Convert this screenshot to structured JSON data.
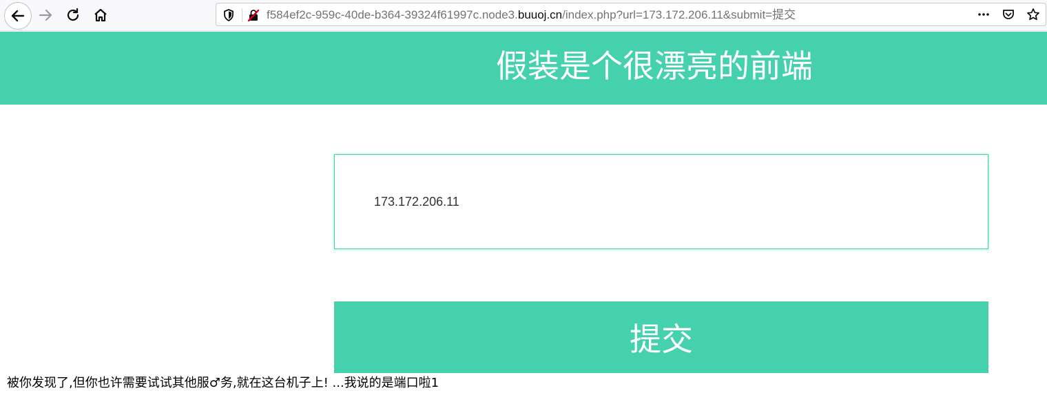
{
  "browser": {
    "url": {
      "prefix": "f584ef2c-959c-40de-b364-39324f61997c.node3.",
      "domain": "buuoj.cn",
      "suffix": "/index.php?url=173.172.206.11&submit=提交"
    },
    "toolbar_icons": [
      "back-icon",
      "forward-icon",
      "reload-icon",
      "home-icon"
    ],
    "urlbar_icons": [
      "tracking-shield-icon",
      "insecure-lock-icon",
      "page-actions-icon",
      "pocket-icon",
      "bookmark-star-icon"
    ]
  },
  "page": {
    "header_title": "假装是个很漂亮的前端",
    "input_value": "173.172.206.11",
    "submit_label": "提交",
    "result_message": "被你发现了,但你也许需要试试其他服♂务,就在这台机子上! ...我说的是端口啦1"
  },
  "colors": {
    "accent": "#45d1ae",
    "header_text": "#ffffff",
    "body_text": "#000000"
  }
}
